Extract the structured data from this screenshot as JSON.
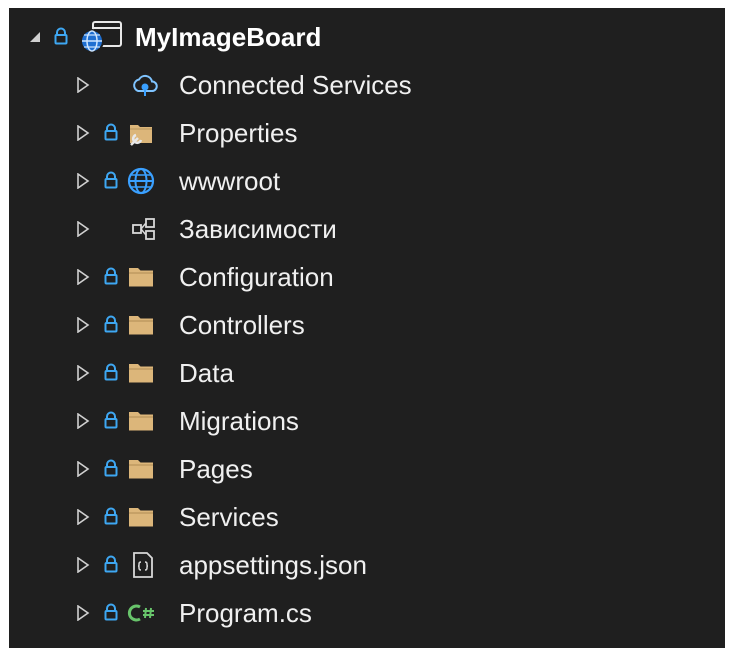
{
  "solution_explorer": {
    "project": {
      "name": "MyImageBoard",
      "expanded": true
    },
    "items": [
      {
        "label": "Connected Services",
        "icon": "connected-services-icon",
        "locked": false
      },
      {
        "label": "Properties",
        "icon": "properties-folder-icon",
        "locked": true
      },
      {
        "label": "wwwroot",
        "icon": "globe-icon",
        "locked": true
      },
      {
        "label": "Зависимости",
        "icon": "dependencies-icon",
        "locked": false
      },
      {
        "label": "Configuration",
        "icon": "folder-icon",
        "locked": true
      },
      {
        "label": "Controllers",
        "icon": "folder-icon",
        "locked": true
      },
      {
        "label": "Data",
        "icon": "folder-icon",
        "locked": true
      },
      {
        "label": "Migrations",
        "icon": "folder-icon",
        "locked": true
      },
      {
        "label": "Pages",
        "icon": "folder-icon",
        "locked": true
      },
      {
        "label": "Services",
        "icon": "folder-icon",
        "locked": true
      },
      {
        "label": "appsettings.json",
        "icon": "json-file-icon",
        "locked": true
      },
      {
        "label": "Program.cs",
        "icon": "csharp-file-icon",
        "locked": true
      }
    ],
    "colors": {
      "background": "#1f1f1f",
      "lock": "#3ea7f2",
      "folder": "#dcb67a",
      "csharp": "#68c46b",
      "globe": "#3aa0ff"
    }
  }
}
